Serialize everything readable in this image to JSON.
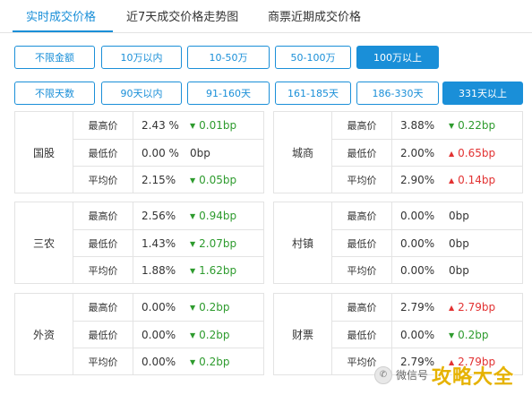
{
  "tabs": [
    {
      "label": "实时成交价格",
      "active": true
    },
    {
      "label": "近7天成交价格走势图",
      "active": false
    },
    {
      "label": "商票近期成交价格",
      "active": false
    }
  ],
  "amount_filters": [
    {
      "label": "不限金额",
      "active": false
    },
    {
      "label": "10万以内",
      "active": false
    },
    {
      "label": "10-50万",
      "active": false
    },
    {
      "label": "50-100万",
      "active": false
    },
    {
      "label": "100万以上",
      "active": true
    }
  ],
  "days_filters": [
    {
      "label": "不限天数",
      "active": false
    },
    {
      "label": "90天以内",
      "active": false
    },
    {
      "label": "91-160天",
      "active": false
    },
    {
      "label": "161-185天",
      "active": false
    },
    {
      "label": "186-330天",
      "active": false
    },
    {
      "label": "331天以上",
      "active": true
    }
  ],
  "panels": [
    {
      "name": "国股",
      "rows": [
        {
          "label": "最高价",
          "value": "2.43 %",
          "change": "0.01bp",
          "dir": "down"
        },
        {
          "label": "最低价",
          "value": "0.00 %",
          "change": "0bp",
          "dir": "flat"
        },
        {
          "label": "平均价",
          "value": "2.15%",
          "change": "0.05bp",
          "dir": "down"
        }
      ]
    },
    {
      "name": "城商",
      "rows": [
        {
          "label": "最高价",
          "value": "3.88%",
          "change": "0.22bp",
          "dir": "down"
        },
        {
          "label": "最低价",
          "value": "2.00%",
          "change": "0.65bp",
          "dir": "up"
        },
        {
          "label": "平均价",
          "value": "2.90%",
          "change": "0.14bp",
          "dir": "up"
        }
      ]
    },
    {
      "name": "三农",
      "rows": [
        {
          "label": "最高价",
          "value": "2.56%",
          "change": "0.94bp",
          "dir": "down"
        },
        {
          "label": "最低价",
          "value": "1.43%",
          "change": "2.07bp",
          "dir": "down"
        },
        {
          "label": "平均价",
          "value": "1.88%",
          "change": "1.62bp",
          "dir": "down"
        }
      ]
    },
    {
      "name": "村镇",
      "rows": [
        {
          "label": "最高价",
          "value": "0.00%",
          "change": "0bp",
          "dir": "flat"
        },
        {
          "label": "最低价",
          "value": "0.00%",
          "change": "0bp",
          "dir": "flat"
        },
        {
          "label": "平均价",
          "value": "0.00%",
          "change": "0bp",
          "dir": "flat"
        }
      ]
    },
    {
      "name": "外资",
      "rows": [
        {
          "label": "最高价",
          "value": "0.00%",
          "change": "0.2bp",
          "dir": "down"
        },
        {
          "label": "最低价",
          "value": "0.00%",
          "change": "0.2bp",
          "dir": "down"
        },
        {
          "label": "平均价",
          "value": "0.00%",
          "change": "0.2bp",
          "dir": "down"
        }
      ]
    },
    {
      "name": "财票",
      "rows": [
        {
          "label": "最高价",
          "value": "2.79%",
          "change": "2.79bp",
          "dir": "up"
        },
        {
          "label": "最低价",
          "value": "0.00%",
          "change": "0.2bp",
          "dir": "down"
        },
        {
          "label": "平均价",
          "value": "2.79%",
          "change": "2.79bp",
          "dir": "up"
        }
      ]
    }
  ],
  "watermark": {
    "text": "微信号",
    "brand": "攻略大全"
  },
  "colors": {
    "accent": "#1a8fd8",
    "down": "#2e9b2e",
    "up": "#e23232",
    "border": "#e3e3e3"
  }
}
